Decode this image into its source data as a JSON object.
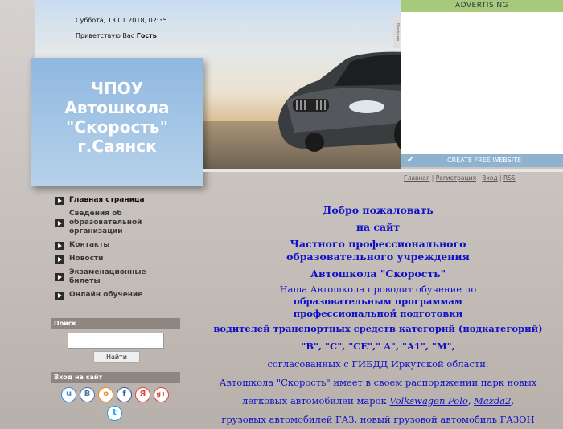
{
  "header": {
    "date": "Суббота, 13.01.2018, 02:35",
    "greeting_prefix": "Приветствую Вас",
    "greeting_user": "Гость",
    "logo_lines": [
      "ЧПОУ",
      "Автошкола",
      "\"Скорость\"",
      "г.Саянск"
    ]
  },
  "ad": {
    "top_label": "ADVERTISING",
    "bottom_label": "CREATE FREE WEBSITE",
    "side_label": "Реклама"
  },
  "top_links": [
    "Главная",
    "Регистрация",
    "Вход",
    "RSS"
  ],
  "menu": {
    "items": [
      {
        "label": "Главная страница"
      },
      {
        "label": "Сведения об образовательной организации"
      },
      {
        "label": "Контакты"
      },
      {
        "label": "Новости"
      },
      {
        "label": "Экзаменационные билеты"
      },
      {
        "label": "Онлайн обучение"
      }
    ]
  },
  "search": {
    "title": "Поиск",
    "button": "Найти",
    "placeholder": ""
  },
  "login": {
    "title": "Вход на сайт"
  },
  "social": [
    "u",
    "vk",
    "ok",
    "fb",
    "ya",
    "g+",
    "tw"
  ],
  "main": {
    "welcome": "Добро пожаловать",
    "to_site": "на сайт",
    "org_type": "Частного профессионального образовательного учреждения",
    "school_name": "Автошкола \"Скорость\"",
    "p1_normal": "Наша Автошкола проводит обучение по",
    "p1_bold": "образовательным программам профессиональной подготовки",
    "p2": "водителей транспортных средств категорий (подкатегорий)",
    "p3": "\"B\", \"C\", \"CE\",\" A\", \"A1\", \"M\",",
    "p4": "согласованных с ГИБДД Иркутской области.",
    "p5": "Автошкола \"Скорость\" имеет в своем распоряжении парк новых",
    "p6_pre": "легковых автомобилей марок",
    "p6_link1": "Volkswagen Polo",
    "p6_sep": ",",
    "p6_link2": "Mazda2",
    "p6_end": ",",
    "p7": "грузовых автомобилей ГАЗ, новый грузовой автомобиль ГАЗОН"
  }
}
